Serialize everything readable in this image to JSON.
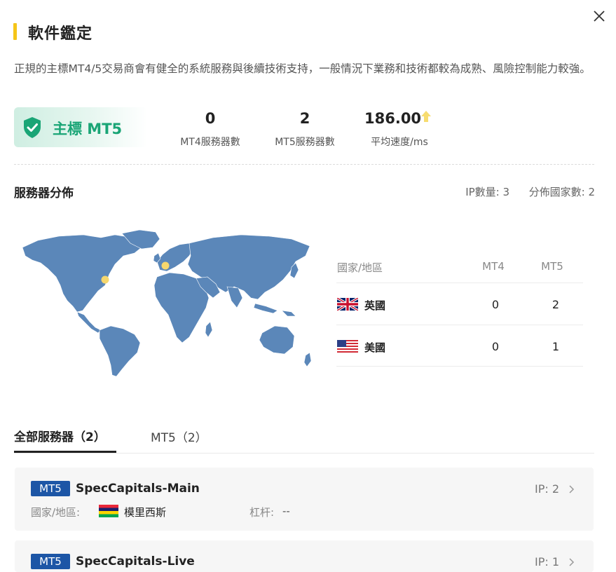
{
  "header": {
    "title": "軟件鑑定"
  },
  "description": "正規的主標MT4/5交易商會有健全的系統服務與後續技術支持，一般情況下業務和技術都較為成熟、風險控制能力較強。",
  "badge": {
    "label": "主標 MT5",
    "icon": "shield-check-icon",
    "color": "#1aa576"
  },
  "stats": [
    {
      "value": "0",
      "label": "MT4服務器數"
    },
    {
      "value": "2",
      "label": "MT5服務器數"
    },
    {
      "value": "186.00",
      "label": "平均速度/ms",
      "indicator": "up-arrow-icon"
    }
  ],
  "distribution": {
    "title": "服務器分佈",
    "ip_count_label": "IP數量:",
    "ip_count": "3",
    "country_count_label": "分佈國家數:",
    "country_count": "2",
    "table": {
      "headers": [
        "國家/地區",
        "MT4",
        "MT5"
      ],
      "rows": [
        {
          "flag": "uk-flag-icon",
          "country": "英國",
          "mt4": "0",
          "mt5": "2"
        },
        {
          "flag": "us-flag-icon",
          "country": "美國",
          "mt4": "0",
          "mt5": "1"
        }
      ]
    }
  },
  "tabs": [
    {
      "label": "全部服務器（2）",
      "active": true
    },
    {
      "label": "MT5（2）",
      "active": false
    }
  ],
  "servers": [
    {
      "tag": "MT5",
      "name": "SpecCapitals-Main",
      "ip_label": "IP:",
      "ip_count": "2",
      "country_label": "國家/地區:",
      "country": "模里西斯",
      "flag": "mauritius-flag-icon",
      "leverage_label": "杠杆:",
      "leverage": "--"
    },
    {
      "tag": "MT5",
      "name": "SpecCapitals-Live",
      "ip_label": "IP:",
      "ip_count": "1"
    }
  ],
  "colors": {
    "accent_yellow": "#f5c518",
    "map_blue": "#5b87b9",
    "tag_blue": "#1d56a6"
  }
}
